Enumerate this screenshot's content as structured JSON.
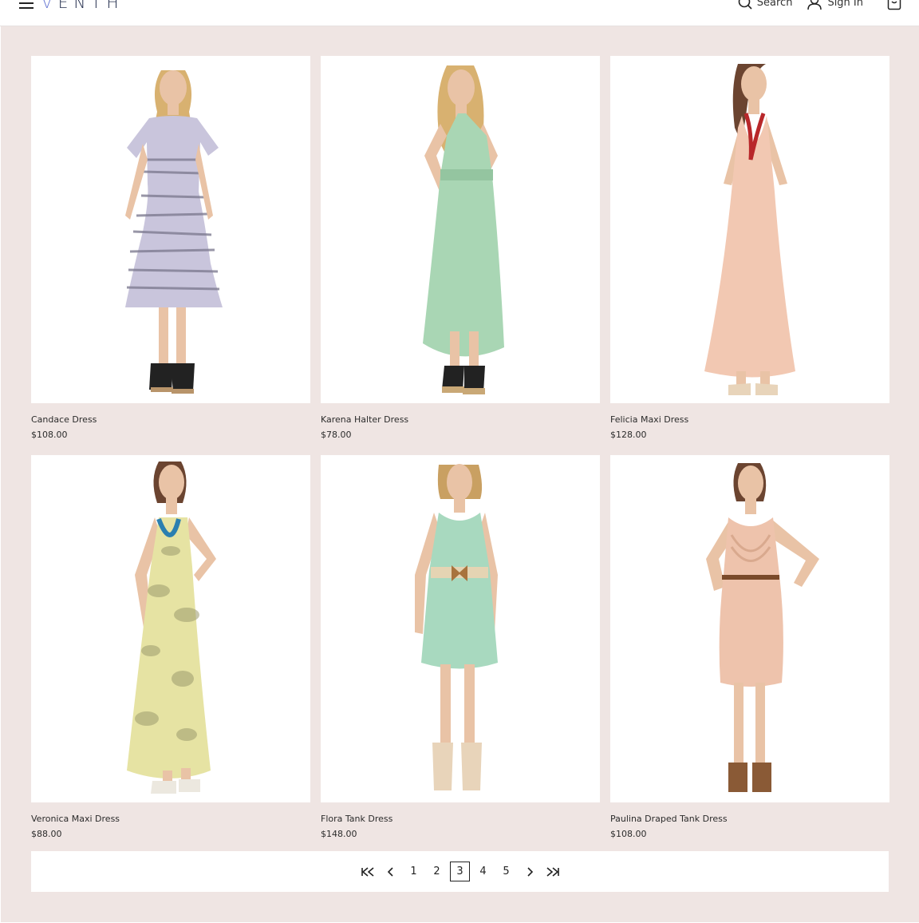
{
  "header": {
    "logo": "ENTH",
    "logo_mark": "V",
    "search_label": "Search",
    "signin_label": "Sign In"
  },
  "colors": {
    "background": "#efe5e3",
    "card": "#ffffff",
    "logo_accent": "#6b7bd4"
  },
  "products": [
    {
      "name": "Candace Dress",
      "price": "$108.00",
      "dress_color": "#c9c5dc",
      "stripe_color": "#7f7c92",
      "style": "midi-stripe"
    },
    {
      "name": "Karena Halter Dress",
      "price": "$78.00",
      "dress_color": "#a9d6b4",
      "style": "halter-hilo"
    },
    {
      "name": "Felicia Maxi Dress",
      "price": "$128.00",
      "dress_color": "#f2c8b2",
      "style": "maxi"
    },
    {
      "name": "Veronica Maxi Dress",
      "price": "$88.00",
      "dress_color": "#e6e3a3",
      "style": "maxi-print"
    },
    {
      "name": "Flora Tank Dress",
      "price": "$148.00",
      "dress_color": "#a8d9bf",
      "style": "short-belt"
    },
    {
      "name": "Paulina Draped Tank Dress",
      "price": "$108.00",
      "dress_color": "#eec3ac",
      "style": "knee-drape"
    }
  ],
  "pagination": {
    "pages": [
      "1",
      "2",
      "3",
      "4",
      "5"
    ],
    "current": "3"
  }
}
